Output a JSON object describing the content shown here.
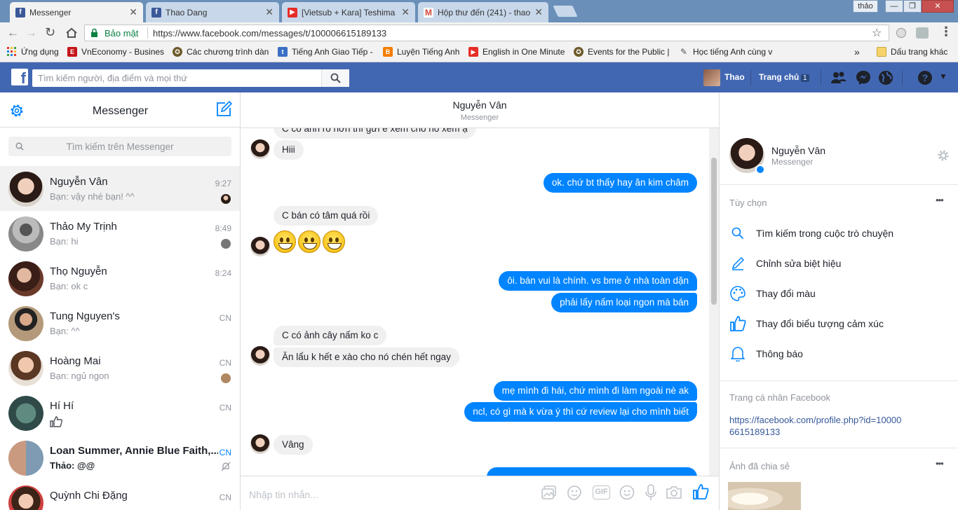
{
  "browser": {
    "tabs": [
      {
        "title": "Messenger",
        "icon": "facebook-icon",
        "color": "#3b5998",
        "active": true
      },
      {
        "title": "Thao Dang",
        "icon": "facebook-icon",
        "color": "#3b5998",
        "active": false
      },
      {
        "title": "[Vietsub + Kara] Teshima",
        "icon": "youtube-icon",
        "color": "#e52d27",
        "active": false
      },
      {
        "title": "Hộp thư đến (241) - thao",
        "icon": "gmail-icon",
        "color": "#d44638",
        "active": false
      }
    ],
    "profile_label": "thảo",
    "secure_label": "Bảo mật",
    "url": "https://www.facebook.com/messages/t/100006615189133",
    "bookmarks": [
      {
        "label": "Ứng dụng",
        "icon": "apps-grid-icon"
      },
      {
        "label": "VnEconomy - Busines",
        "icon": "vneconomy-icon",
        "color": "#c4161c"
      },
      {
        "label": "Các chương trình dành",
        "icon": "seal-icon",
        "color": "#6d5a2a"
      },
      {
        "label": "Tiếng Anh Giao Tiếp -",
        "icon": "t-icon",
        "color": "#3a6fc4"
      },
      {
        "label": "Luyện Tiếng Anh",
        "icon": "blogger-icon",
        "color": "#f57d00"
      },
      {
        "label": "English in One Minute",
        "icon": "youtube-icon",
        "color": "#e52d27"
      },
      {
        "label": "Events for the Public |",
        "icon": "seal-icon",
        "color": "#6d5a2a"
      },
      {
        "label": "Học tiếng Anh cùng v",
        "icon": "bookmark-icon",
        "color": "#555555"
      }
    ],
    "more_bookmarks": "»",
    "other_bookmarks": "Dấu trang khác"
  },
  "fb": {
    "search_placeholder": "Tìm kiếm người, địa điểm và mọi thứ",
    "user_name": "Thao",
    "home_label": "Trang chủ",
    "home_badge": "1",
    "brand_color": "#4267b2"
  },
  "sidebar": {
    "title": "Messenger",
    "search_placeholder": "Tìm kiếm trên Messenger",
    "conversations": [
      {
        "name": "Nguyễn Vân",
        "snippet": "Bạn: vậy nhé bạn! ^^",
        "time": "9:27",
        "bold": false
      },
      {
        "name": "Thảo My Trịnh",
        "snippet": "Bạn: hi",
        "time": "8:49",
        "bold": false
      },
      {
        "name": "Thọ Nguyễn",
        "snippet": "Bạn: ok c",
        "time": "8:24",
        "bold": false
      },
      {
        "name": "Tung Nguyen's",
        "snippet": "Bạn: ^^",
        "time": "CN",
        "bold": false
      },
      {
        "name": "Hoàng Mai",
        "snippet": "Bạn: ngủ ngon",
        "time": "CN",
        "bold": false
      },
      {
        "name": "Hí Hí",
        "snippet": "",
        "time": "CN",
        "bold": false
      },
      {
        "name": "Loan Summer, Annie Blue Faith,...",
        "snippet": "Thảo: @@",
        "time": "CN",
        "bold": true
      },
      {
        "name": "Quỳnh Chi Đặng",
        "snippet": "",
        "time": "CN",
        "bold": false
      }
    ]
  },
  "chat": {
    "header_name": "Nguyễn Vân",
    "header_sub": "Messenger",
    "messages": [
      {
        "side": "in",
        "text": "C có ảnh rõ hơn thì gửi e xem cho nó xem ạ"
      },
      {
        "side": "in",
        "text": "Hiii"
      },
      {
        "side": "out",
        "text": "ok. chứ bt thấy hay ăn kim châm"
      },
      {
        "side": "in",
        "text": "C bán có tâm quá rồi"
      },
      {
        "side": "out",
        "text": "ôi. bán vui là chính. vs bme ở nhà toàn dặn"
      },
      {
        "side": "out",
        "text": "phải lấy nấm loại ngon mà bán"
      },
      {
        "side": "in",
        "text": "C có ảnh cây nấm ko c"
      },
      {
        "side": "in",
        "text": "Ăn lẩu k hết e xào cho nó chén hết ngay"
      },
      {
        "side": "out",
        "text": "mẹ mình đi hái, chứ mình đi làm ngoài nè ak"
      },
      {
        "side": "out",
        "text": "ncl, có gì mà k vừa ý thì cứ review lại cho mình biết"
      },
      {
        "side": "in",
        "text": "Vâng"
      }
    ],
    "composer_placeholder": "Nhập tin nhắn...",
    "gif_label": "GIF",
    "accent_color": "#0084ff"
  },
  "info": {
    "name": "Nguyễn Vân",
    "sub": "Messenger",
    "options_title": "Tùy chọn",
    "options": [
      {
        "label": "Tìm kiếm trong cuộc trò chuyện",
        "icon": "search-icon"
      },
      {
        "label": "Chỉnh sửa biệt hiệu",
        "icon": "pencil-icon"
      },
      {
        "label": "Thay đổi màu",
        "icon": "palette-icon"
      },
      {
        "label": "Thay đổi biểu tượng cảm xúc",
        "icon": "thumbs-up-icon"
      },
      {
        "label": "Thông báo",
        "icon": "bell-icon"
      }
    ],
    "profile_title": "Trang cá nhân Facebook",
    "profile_link": "https://facebook.com/profile.php?id=100006615189133",
    "shared_title": "Ảnh đã chia sẻ",
    "more": "•••"
  }
}
